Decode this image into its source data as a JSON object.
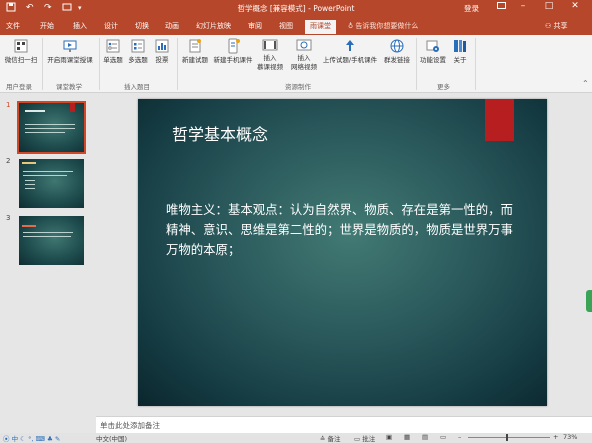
{
  "window": {
    "title": "哲学概念 [兼容模式] - PowerPoint",
    "login": "登录",
    "share": "共享"
  },
  "quick_access": {
    "save_icon": "save-icon",
    "undo_icon": "undo-icon",
    "redo_icon": "redo-icon",
    "present_icon": "present-icon"
  },
  "tabs": [
    {
      "label": "文件"
    },
    {
      "label": "开始"
    },
    {
      "label": "插入"
    },
    {
      "label": "设计"
    },
    {
      "label": "切换"
    },
    {
      "label": "动画"
    },
    {
      "label": "幻灯片放映"
    },
    {
      "label": "审阅"
    },
    {
      "label": "视图"
    },
    {
      "label": "雨课堂"
    }
  ],
  "tell_me": {
    "placeholder": "告诉我你想要做什么"
  },
  "ribbon": {
    "buttons": [
      {
        "label": "微信扫一扫"
      },
      {
        "label": "开启雨课堂授课"
      },
      {
        "label": "单选题"
      },
      {
        "label": "多选题"
      },
      {
        "label": "投票"
      },
      {
        "label": "新建试题"
      },
      {
        "label": "新建手机课件"
      },
      {
        "label": "插入",
        "label2": "慕课视频"
      },
      {
        "label": "插入",
        "label2": "网络视频"
      },
      {
        "label": "上传试题/手机课件"
      },
      {
        "label": "群发链接"
      },
      {
        "label": "功能设置"
      },
      {
        "label": "关于"
      }
    ],
    "groups": [
      {
        "label": "用户登录"
      },
      {
        "label": "课堂教学"
      },
      {
        "label": "插入题目"
      },
      {
        "label": "资源制作"
      },
      {
        "label": "更多"
      }
    ],
    "accent": "#b7472a"
  },
  "thumbnails": [
    {
      "num": "1",
      "selected": true
    },
    {
      "num": "2",
      "selected": false
    },
    {
      "num": "3",
      "selected": false
    }
  ],
  "slide": {
    "title": "哲学基本概念",
    "body": "唯物主义：基本观点：认为自然界、物质、存在是第一性的，而精神、意识、思维是第二性的；世界是物质的，物质是世界万事万物的本原；"
  },
  "notes": {
    "placeholder": "单击此处添加备注"
  },
  "status": {
    "language": "中文(中国)",
    "notes_label": "备注",
    "comments_label": "批注",
    "zoom": "73%"
  }
}
